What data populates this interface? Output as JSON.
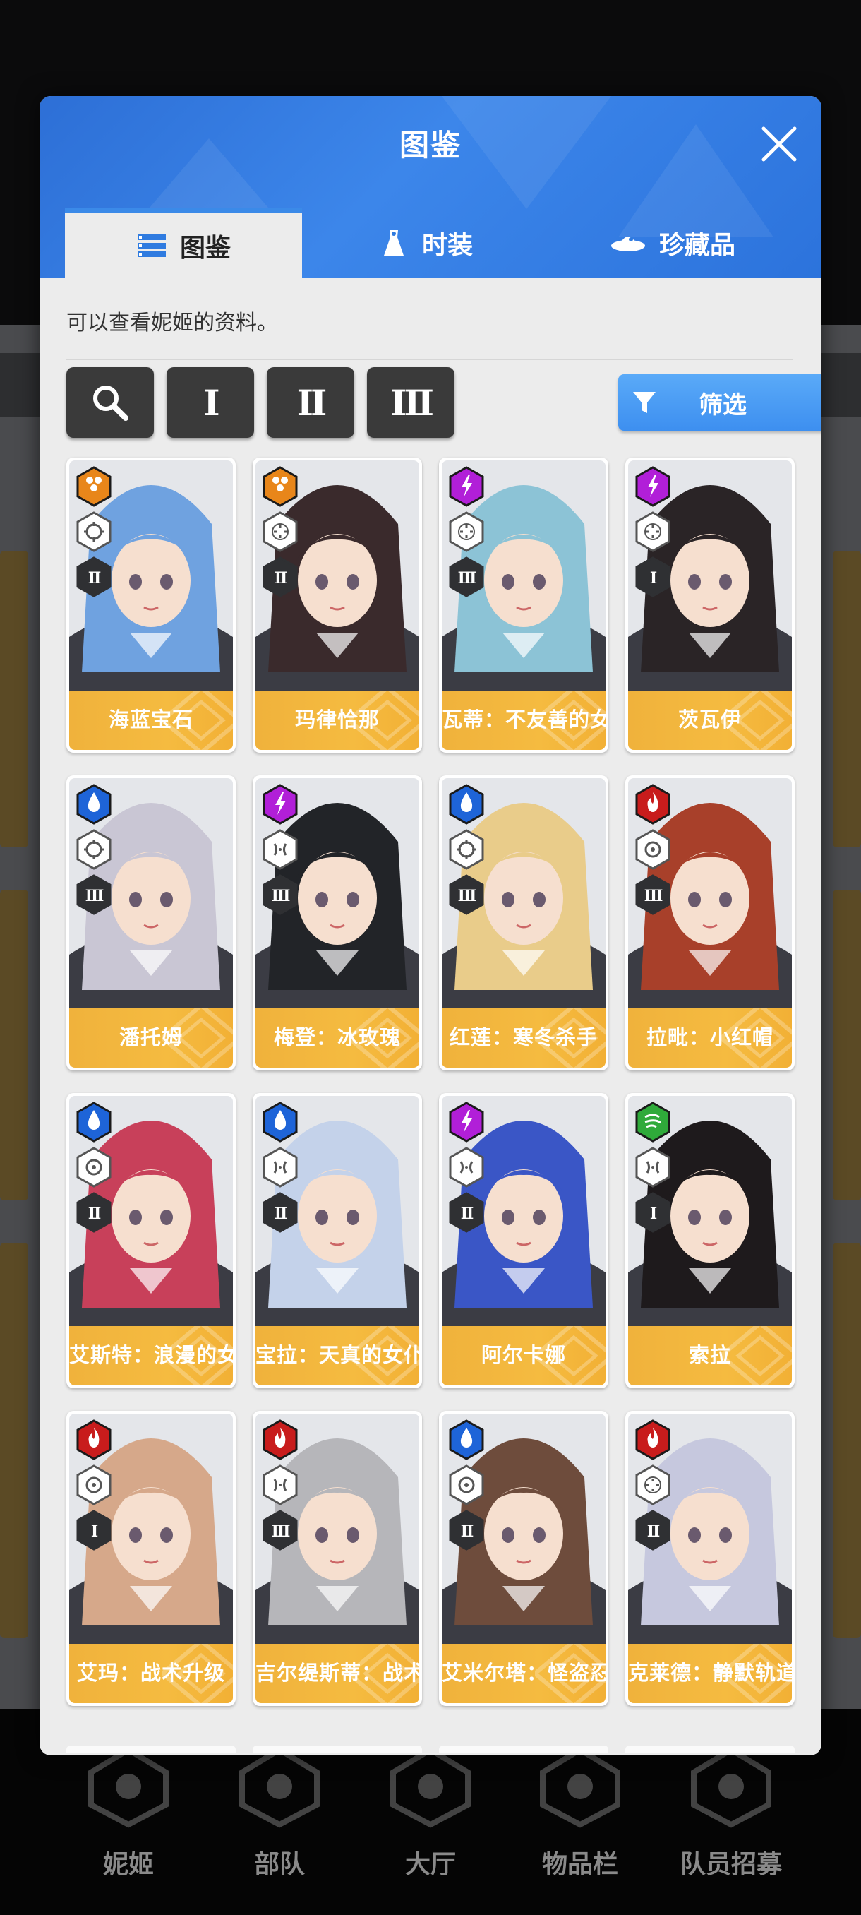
{
  "modal": {
    "title": "图鉴",
    "description": "可以查看妮姬的资料。",
    "tabs": [
      {
        "label": "图鉴",
        "icon": "list-icon",
        "active": true
      },
      {
        "label": "时装",
        "icon": "dress-icon",
        "active": false
      },
      {
        "label": "珍藏品",
        "icon": "collectible-icon",
        "active": false
      }
    ],
    "toolbar": {
      "search_icon": "search-icon",
      "burst": [
        "I",
        "II",
        "III"
      ],
      "filter_label": "筛选"
    }
  },
  "colors": {
    "header_blue": "#3c86ea",
    "card_name_bar": "#f5bb40",
    "element_iron": "#e8861a",
    "element_electric": "#b11fd8",
    "element_water": "#1e64d8",
    "element_fire": "#c81c1c",
    "element_wind": "#2faa3a"
  },
  "cards": [
    {
      "name": "海蓝宝石",
      "element": "iron",
      "weapon": "crosshair",
      "burst": "II",
      "hair": "#6fa2e0"
    },
    {
      "name": "玛律恰那",
      "element": "iron",
      "weapon": "scope",
      "burst": "II",
      "hair": "#3a2a2c"
    },
    {
      "name": "瓦蒂：不友善的女仆",
      "element": "electric",
      "weapon": "scope",
      "burst": "III",
      "hair": "#8cc3d6"
    },
    {
      "name": "茨瓦伊",
      "element": "electric",
      "weapon": "scope",
      "burst": "I",
      "hair": "#2a2426"
    },
    {
      "name": "潘托姆",
      "element": "water",
      "weapon": "crosshair",
      "burst": "III",
      "hair": "#c9c6d4"
    },
    {
      "name": "梅登：冰玫瑰",
      "element": "electric",
      "weapon": "split",
      "burst": "III",
      "hair": "#222428"
    },
    {
      "name": "红莲：寒冬杀手",
      "element": "water",
      "weapon": "crosshair",
      "burst": "III",
      "hair": "#e9cc8a"
    },
    {
      "name": "拉毗：小红帽",
      "element": "fire",
      "weapon": "dot",
      "burst": "III",
      "hair": "#a8402a"
    },
    {
      "name": "艾斯特：浪漫的女仆",
      "element": "water",
      "weapon": "dot",
      "burst": "II",
      "hair": "#c8405a"
    },
    {
      "name": "宝拉：天真的女仆",
      "element": "water",
      "weapon": "split",
      "burst": "II",
      "hair": "#c4d2ea"
    },
    {
      "name": "阿尔卡娜",
      "element": "electric",
      "weapon": "split",
      "burst": "II",
      "hair": "#3a56c6"
    },
    {
      "name": "索拉",
      "element": "wind",
      "weapon": "split",
      "burst": "I",
      "hair": "#1e1a1c"
    },
    {
      "name": "艾玛：战术升级",
      "element": "fire",
      "weapon": "dot",
      "burst": "I",
      "hair": "#d6a88a"
    },
    {
      "name": "吉尔缇斯蒂：战术升级",
      "element": "fire",
      "weapon": "split",
      "burst": "III",
      "hair": "#b6b6ba"
    },
    {
      "name": "艾米尔塔：怪盗忍者",
      "element": "water",
      "weapon": "dot",
      "burst": "II",
      "hair": "#6e4c3c"
    },
    {
      "name": "克莱德：静默轨道",
      "element": "fire",
      "weapon": "scope",
      "burst": "II",
      "hair": "#c6c8de"
    }
  ],
  "bottom_nav": [
    {
      "label": "妮姬",
      "icon": "nikke-icon"
    },
    {
      "label": "部队",
      "icon": "squad-icon"
    },
    {
      "label": "大厅",
      "icon": "lobby-icon"
    },
    {
      "label": "物品栏",
      "icon": "inventory-icon"
    },
    {
      "label": "队员招募",
      "icon": "recruit-icon"
    }
  ]
}
